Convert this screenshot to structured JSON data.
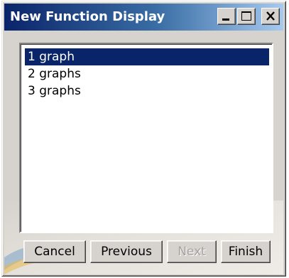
{
  "window": {
    "title": "New Function Display"
  },
  "titlebar_buttons": {
    "minimize_icon": "minimize-icon",
    "maximize_icon": "maximize-icon",
    "close_icon": "close-icon"
  },
  "list": {
    "items": [
      {
        "label": "1 graph",
        "selected": true
      },
      {
        "label": "2 graphs",
        "selected": false
      },
      {
        "label": "3 graphs",
        "selected": false
      }
    ]
  },
  "buttons": {
    "cancel": "Cancel",
    "previous": "Previous",
    "next": "Next",
    "finish": "Finish",
    "next_enabled": false
  },
  "colors": {
    "titlebar_start": "#0a246a",
    "titlebar_end": "#a6caf0",
    "selection": "#0a246a",
    "face": "#d6d3ce"
  }
}
